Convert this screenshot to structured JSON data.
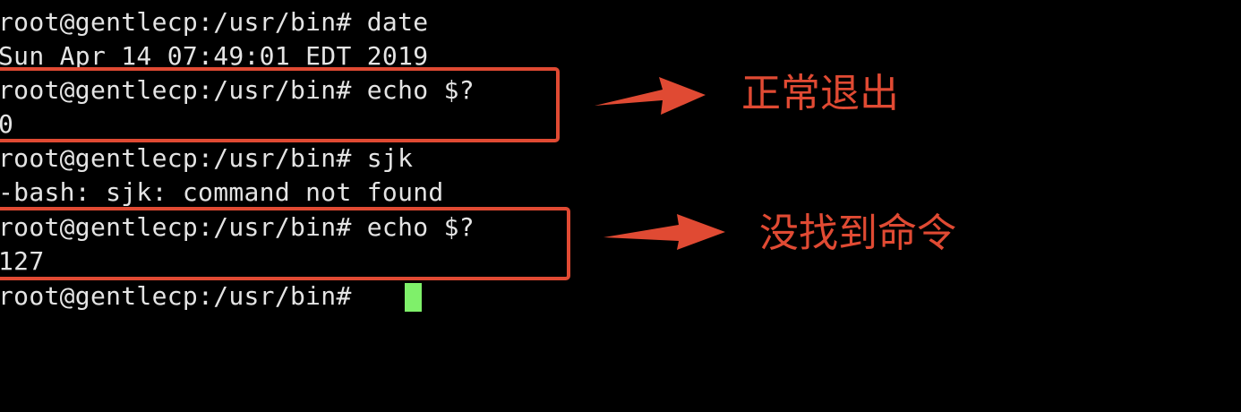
{
  "terminal": {
    "lines": [
      "root@gentlecp:/usr/bin# date",
      "Sun Apr 14 07:49:01 EDT 2019",
      "root@gentlecp:/usr/bin# echo $?",
      "0",
      "root@gentlecp:/usr/bin# sjk",
      "-bash: sjk: command not found",
      "root@gentlecp:/usr/bin# echo $?",
      "127",
      "root@gentlecp:/usr/bin# "
    ],
    "cursor_color": "#7ff06a",
    "text_color": "#e4e4e4",
    "background": "#000000"
  },
  "annotations": {
    "color": "#e04a33",
    "normal_exit": "正常退出",
    "command_not_found": "没找到命令"
  }
}
